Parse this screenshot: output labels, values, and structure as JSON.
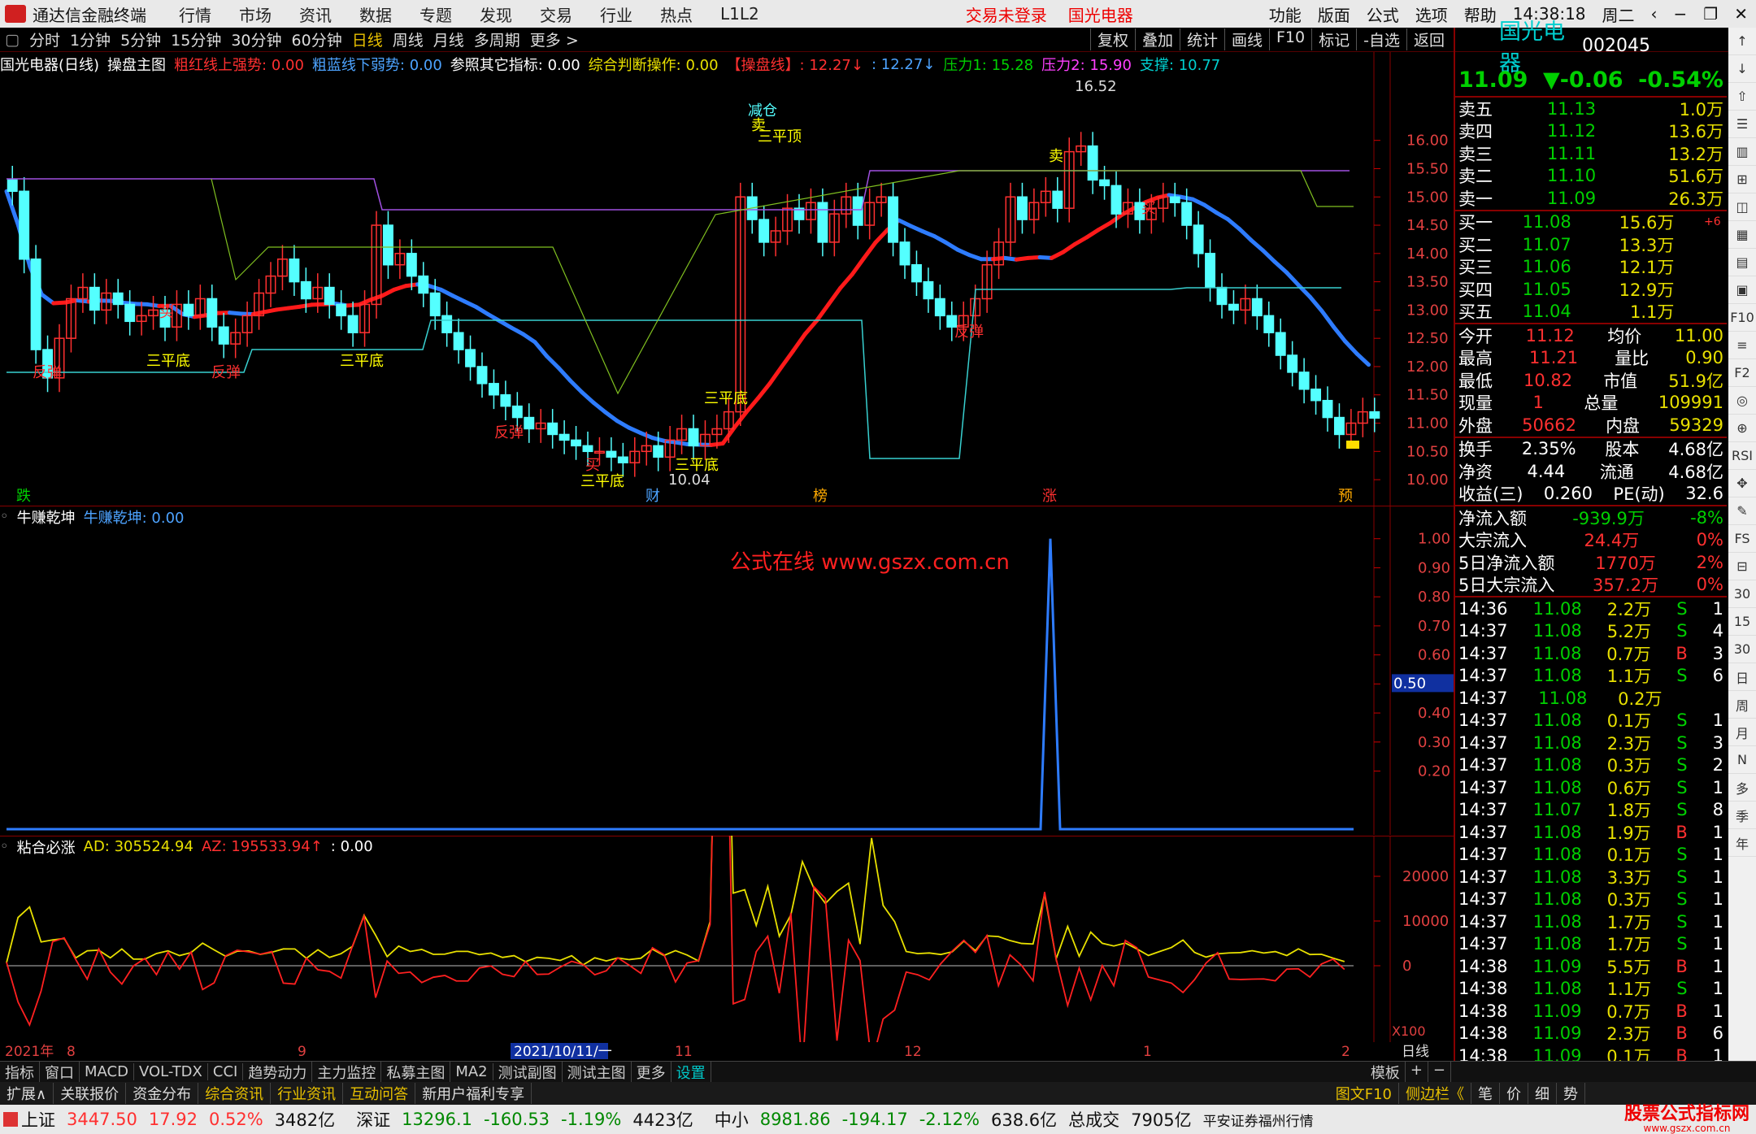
{
  "titlebar": {
    "app": "通达信金融终端",
    "menus": [
      "行情",
      "市场",
      "资讯",
      "数据",
      "专题",
      "发现",
      "交易",
      "行业",
      "热点",
      "L1L2"
    ],
    "alert1": "交易未登录",
    "alert2": "国光电器",
    "right_menus": [
      "功能",
      "版面",
      "公式",
      "选项",
      "帮助"
    ],
    "clock": "14:38:18",
    "weekday": "周二"
  },
  "periodbar": {
    "items": [
      "分时",
      "1分钟",
      "5分钟",
      "15分钟",
      "30分钟",
      "60分钟",
      "日线",
      "周线",
      "月线",
      "多周期",
      "更多 >"
    ],
    "active": "日线",
    "right": [
      "复权",
      "叠加",
      "统计",
      "画线",
      "F10",
      "标记",
      "-自选",
      "返回"
    ]
  },
  "main_head": {
    "name": "国光电器(日线)",
    "tpl": "操盘主图",
    "i1": "粗红线上强势: 0.00",
    "i2": "粗蓝线下弱势: 0.00",
    "i3": "参照其它指标: 0.00",
    "i4": "综合判断操作: 0.00",
    "i5": "【操盘线】: 12.27↓",
    "i6": ": 12.27↓",
    "i7": "压力1: 15.28",
    "i8": "压力2: 15.90",
    "i9": "支撑: 10.77"
  },
  "sub1_head": {
    "name": "牛赚乾坤",
    "val": "牛赚乾坤: 0.00"
  },
  "sub2_head": {
    "name": "粘合必涨",
    "ad": "AD: 305524.94",
    "az": "AZ: 195533.94↑",
    "extra": ": 0.00"
  },
  "watermark": "公式在线  www.gszx.com.cn",
  "main_labels": {
    "high": "16.52",
    "low": "10.04"
  },
  "price_axis": [
    "16.00",
    "15.50",
    "15.00",
    "14.50",
    "14.00",
    "13.50",
    "13.00",
    "12.50",
    "12.00",
    "11.50",
    "11.00",
    "10.50",
    "10.00"
  ],
  "sub1_axis": [
    "1.00",
    "0.90",
    "0.80",
    "0.70",
    "0.60",
    "0.50",
    "0.40",
    "0.30",
    "0.20"
  ],
  "sub1_cursor": "0.50",
  "sub2_axis": [
    "20000",
    "10000",
    "0"
  ],
  "sub2_scale": "X100",
  "date_axis": {
    "items": [
      "2021年",
      "8",
      "9",
      "2021/10/11/一",
      "11",
      "12",
      "1",
      "2"
    ],
    "period": "日线"
  },
  "signals": {
    "fantan": "反弹",
    "sanpingdi": "三平底",
    "sanpingding": "三平顶",
    "jiancang": "减仓",
    "mai": "卖",
    "buy": "买",
    "die": "跌",
    "cai": "财",
    "bang": "榜",
    "zhang": "涨",
    "yu": "预"
  },
  "stock": {
    "name": "国光电器",
    "code": "002045",
    "price": "11.09",
    "change": "▼-0.06",
    "pct": "-0.54%"
  },
  "asks": [
    {
      "l": "卖五",
      "p": "11.13",
      "v": "1.0万"
    },
    {
      "l": "卖四",
      "p": "11.12",
      "v": "13.6万"
    },
    {
      "l": "卖三",
      "p": "11.11",
      "v": "13.2万"
    },
    {
      "l": "卖二",
      "p": "11.10",
      "v": "51.6万"
    },
    {
      "l": "卖一",
      "p": "11.09",
      "v": "26.3万"
    }
  ],
  "bids": [
    {
      "l": "买一",
      "p": "11.08",
      "v": "15.6万",
      "x": "+6"
    },
    {
      "l": "买二",
      "p": "11.07",
      "v": "13.3万"
    },
    {
      "l": "买三",
      "p": "11.06",
      "v": "12.1万"
    },
    {
      "l": "买四",
      "p": "11.05",
      "v": "12.9万"
    },
    {
      "l": "买五",
      "p": "11.04",
      "v": "1.1万"
    }
  ],
  "quote": [
    [
      "今开",
      "11.12",
      "均价",
      "11.00"
    ],
    [
      "最高",
      "11.21",
      "量比",
      "0.90"
    ],
    [
      "最低",
      "10.82",
      "市值",
      "51.9亿"
    ],
    [
      "现量",
      "1",
      "总量",
      "109991"
    ],
    [
      "外盘",
      "50662",
      "内盘",
      "59329"
    ]
  ],
  "quote2": [
    [
      "换手",
      "2.35%",
      "股本",
      "4.68亿"
    ],
    [
      "净资",
      "4.44",
      "流通",
      "4.68亿"
    ],
    [
      "收益(三)",
      "0.260",
      "PE(动)",
      "32.6"
    ]
  ],
  "flows": [
    [
      "净流入额",
      "-939.9万",
      "-8%"
    ],
    [
      "大宗流入",
      "24.4万",
      "0%"
    ],
    [
      "5日净流入额",
      "1770万",
      "2%"
    ],
    [
      "5日大宗流入",
      "357.2万",
      "0%"
    ]
  ],
  "ticks": [
    [
      "14:36",
      "11.08",
      "2.2万",
      "S",
      "1"
    ],
    [
      "14:37",
      "11.08",
      "5.2万",
      "S",
      "4"
    ],
    [
      "14:37",
      "11.08",
      "0.7万",
      "B",
      "3"
    ],
    [
      "14:37",
      "11.08",
      "1.1万",
      "S",
      "6"
    ],
    [
      "14:37",
      "11.08",
      "0.2万",
      "",
      ""
    ],
    [
      "14:37",
      "11.08",
      "0.1万",
      "S",
      "1"
    ],
    [
      "14:37",
      "11.08",
      "2.3万",
      "S",
      "3"
    ],
    [
      "14:37",
      "11.08",
      "0.3万",
      "S",
      "2"
    ],
    [
      "14:37",
      "11.08",
      "0.6万",
      "S",
      "1"
    ],
    [
      "14:37",
      "11.07",
      "1.8万",
      "S",
      "8"
    ],
    [
      "14:37",
      "11.08",
      "1.9万",
      "B",
      "1"
    ],
    [
      "14:37",
      "11.08",
      "0.1万",
      "S",
      "1"
    ],
    [
      "14:37",
      "11.08",
      "3.3万",
      "S",
      "1"
    ],
    [
      "14:37",
      "11.08",
      "0.3万",
      "S",
      "1"
    ],
    [
      "14:37",
      "11.08",
      "1.7万",
      "S",
      "1"
    ],
    [
      "14:37",
      "11.08",
      "1.7万",
      "S",
      "1"
    ],
    [
      "14:38",
      "11.09",
      "5.5万",
      "B",
      "1"
    ],
    [
      "14:38",
      "11.08",
      "1.1万",
      "S",
      "1"
    ],
    [
      "14:38",
      "11.09",
      "0.7万",
      "B",
      "1"
    ],
    [
      "14:38",
      "11.09",
      "2.3万",
      "B",
      "6"
    ],
    [
      "14:38",
      "11.09",
      "0.1万",
      "B",
      "1"
    ]
  ],
  "sidebar": [
    "↑",
    "↓",
    "⇧",
    "☰",
    "▥",
    "⊞",
    "◫",
    "▦",
    "▤",
    "▣",
    "F10",
    "≡",
    "F2",
    "◎",
    "⊕",
    "RSI",
    "✥",
    "✎",
    "FS",
    "⊟",
    "30",
    "15",
    "30",
    "日",
    "周",
    "月",
    "N",
    "多",
    "季",
    "年"
  ],
  "bottomtabs": [
    "指标",
    "窗口",
    "MACD",
    "VOL-TDX",
    "CCI",
    "趋势动力",
    "主力监控",
    "私募主图",
    "MA2",
    "测试副图",
    "测试主图",
    "更多",
    "设置"
  ],
  "bottomtabs_right": [
    "模板",
    "+",
    "−"
  ],
  "linkbar": [
    "扩展∧",
    "关联报价",
    "资金分布",
    "综合资讯",
    "行业资讯",
    "互动问答",
    "新用户福利专享"
  ],
  "linkbar_right": [
    "图文F10",
    "侧边栏《",
    "笔",
    "价",
    "细",
    "势"
  ],
  "statusbar": {
    "sh": "上证",
    "sh_v": "3447.50",
    "sh_c": "17.92",
    "sh_p": "0.52%",
    "sh_a": "3482亿",
    "sz": "深证",
    "sz_v": "13296.1",
    "sz_c": "-160.53",
    "sz_p": "-1.19%",
    "sz_a": "4423亿",
    "zx": "中小",
    "zx_v": "8981.86",
    "zx_c": "-194.17",
    "zx_p": "-2.12%",
    "zx_a": "638.6亿",
    "tot": "总成交",
    "tot_v": "7905亿",
    "broker": "平安证券福州行情",
    "ad": "股票公式指标网",
    "ad_url": "www.gszx.com.cn"
  },
  "chart_data": {
    "type": "candlestick",
    "closes": [
      15.1,
      13.9,
      12.3,
      11.8,
      12.5,
      13.2,
      13.4,
      13.0,
      13.3,
      13.1,
      12.8,
      12.9,
      13.0,
      12.7,
      13.1,
      12.9,
      13.2,
      12.7,
      12.4,
      12.6,
      12.9,
      13.3,
      13.6,
      13.9,
      13.5,
      13.2,
      13.4,
      13.1,
      12.9,
      12.6,
      13.1,
      14.5,
      13.8,
      14.0,
      13.6,
      13.3,
      12.9,
      12.6,
      12.3,
      12.0,
      11.7,
      11.5,
      11.3,
      11.1,
      10.9,
      11.0,
      10.8,
      10.7,
      10.6,
      10.5,
      10.5,
      10.4,
      10.3,
      10.5,
      10.6,
      10.4,
      10.7,
      10.9,
      10.6,
      10.8,
      10.9,
      11.2,
      15.0,
      14.6,
      14.2,
      14.4,
      14.8,
      14.6,
      14.9,
      14.2,
      14.7,
      15.0,
      14.5,
      14.9,
      15.0,
      14.2,
      13.8,
      13.5,
      13.2,
      12.9,
      12.7,
      12.9,
      13.2,
      13.8,
      14.2,
      15.0,
      14.6,
      14.9,
      15.1,
      14.8,
      15.8,
      15.9,
      15.3,
      15.2,
      14.7,
      14.9,
      14.6,
      14.8,
      15.0,
      14.9,
      14.5,
      14.0,
      13.4,
      13.1,
      13.0,
      13.2,
      12.9,
      12.6,
      12.2,
      11.9,
      11.6,
      11.4,
      11.1,
      10.8,
      11.0,
      11.2,
      11.09
    ]
  }
}
